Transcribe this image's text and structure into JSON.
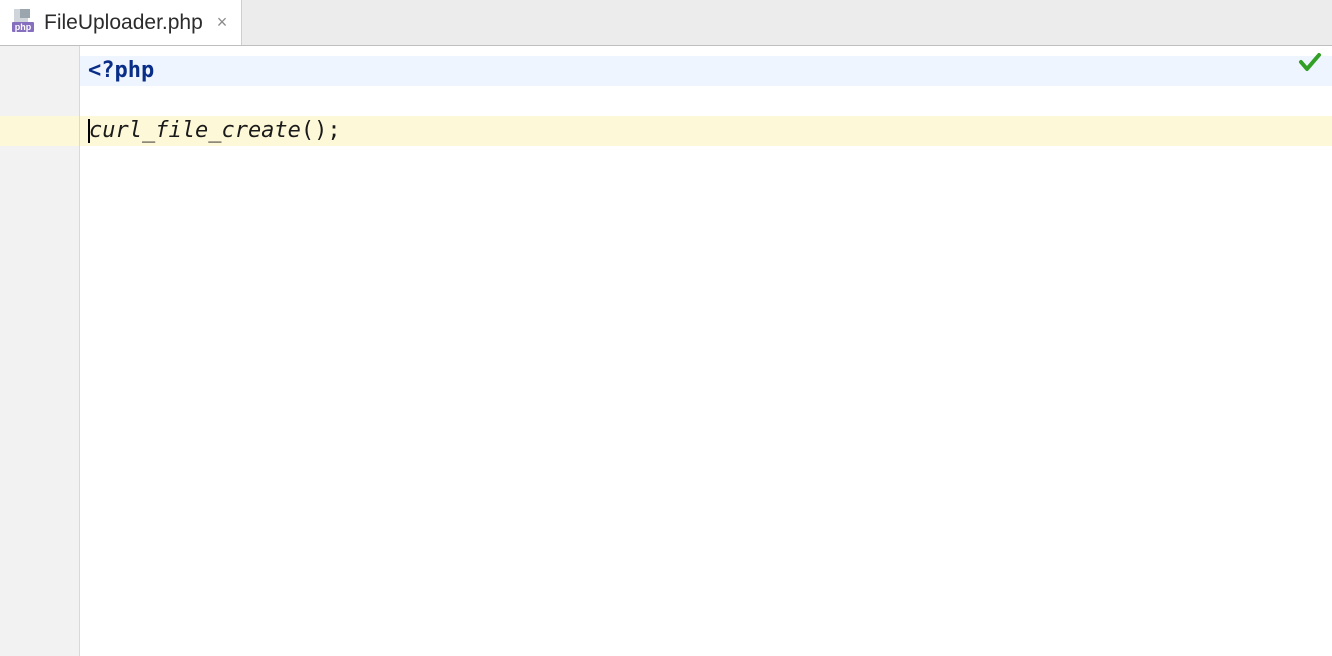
{
  "tabbar": {
    "tabs": [
      {
        "label": "FileUploader.php",
        "close_glyph": "×",
        "icon_badge": "php"
      }
    ]
  },
  "status": {
    "analysis_ok_tooltip": "No problems"
  },
  "code": {
    "lines": [
      {
        "kind": "php_open",
        "text": "<?php",
        "bg": "blue"
      },
      {
        "kind": "blank",
        "text": "",
        "bg": "none"
      },
      {
        "kind": "stmt",
        "func": "curl_file_create",
        "args": "()",
        "semi": ";",
        "bg": "yellow",
        "caret_before": true
      }
    ]
  }
}
